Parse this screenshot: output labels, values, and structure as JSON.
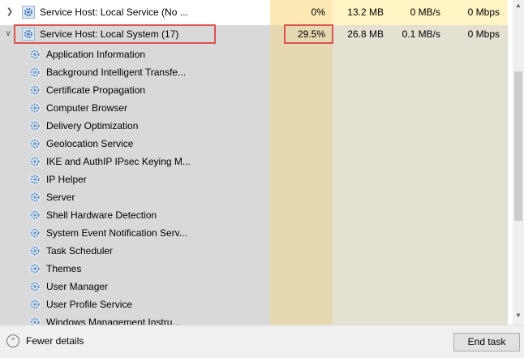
{
  "colors": {
    "cpu_column": "#fde9b4",
    "other_columns": "#fff4c4",
    "selected_row": "#d9d9d9",
    "selected_cpu": "#e6d9b2",
    "selected_other": "#e4e1d3",
    "highlight_border": "#d9534f"
  },
  "processes": [
    {
      "name": "Service Host: Local Service (No ...",
      "cpu": "0%",
      "memory": "13.2 MB",
      "disk": "0 MB/s",
      "network": "0 Mbps",
      "icon": "gear-icon",
      "expand": "chevron-right-icon",
      "selected": false
    },
    {
      "name": "Service Host: Local System (17)",
      "cpu": "29.5%",
      "memory": "26.8 MB",
      "disk": "0.1 MB/s",
      "network": "0 Mbps",
      "icon": "gear-icon",
      "expand": "chevron-down-icon",
      "selected": true
    }
  ],
  "services": [
    {
      "name": "Application Information"
    },
    {
      "name": "Background Intelligent Transfe..."
    },
    {
      "name": "Certificate Propagation"
    },
    {
      "name": "Computer Browser"
    },
    {
      "name": "Delivery Optimization"
    },
    {
      "name": "Geolocation Service"
    },
    {
      "name": "IKE and AuthIP IPsec Keying M..."
    },
    {
      "name": "IP Helper"
    },
    {
      "name": "Server"
    },
    {
      "name": "Shell Hardware Detection"
    },
    {
      "name": "System Event Notification Serv..."
    },
    {
      "name": "Task Scheduler"
    },
    {
      "name": "Themes"
    },
    {
      "name": "User Manager"
    },
    {
      "name": "User Profile Service"
    },
    {
      "name": "Windows Management Instru..."
    }
  ],
  "footer": {
    "fewer_details_label": "Fewer details",
    "end_task_label": "End task"
  }
}
